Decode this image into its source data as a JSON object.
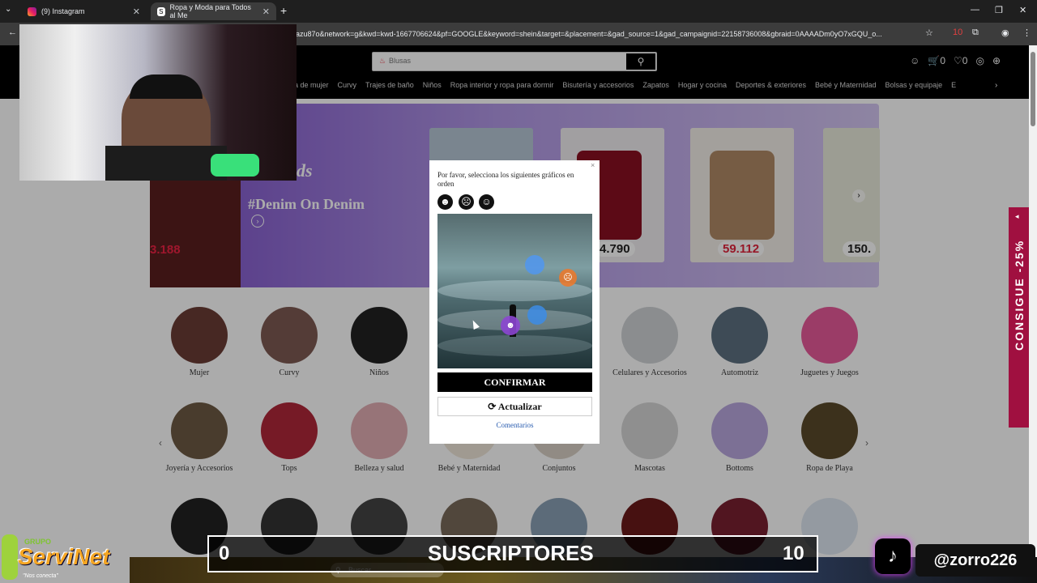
{
  "browser": {
    "tabs": [
      {
        "label": "(9) Instagram"
      },
      {
        "label": "Ropa y Moda para Todos al Me"
      }
    ],
    "url": "azu87o&network=g&kwd=kwd-1667706624&pf=GOOGLE&keyword=shein&target=&placement=&gad_source=1&gad_campaignid=22158736008&gbraid=0AAAADm0yO7xGQU_o...",
    "new_tab": "+",
    "controls": {
      "minimize": "—",
      "restore": "❐",
      "close": "✕"
    },
    "extension_badge": "10"
  },
  "site": {
    "search_value": "Blusas",
    "header_icons": {
      "cart_count": "0",
      "wishlist_count": "0"
    },
    "nav": [
      "ba de mujer",
      "Curvy",
      "Trajes de baño",
      "Niños",
      "Ropa interior y ropa para dormir",
      "Bisutería y accesorios",
      "Zapatos",
      "Hogar y cocina",
      "Deportes & exteriores",
      "Bebé y Maternidad",
      "Bolsas y equipaje",
      "E"
    ],
    "banner": {
      "ds": "ds",
      "title": "#Denim On Denim",
      "left_price": "3.188",
      "prices": [
        "4.790",
        "59.112",
        "150."
      ]
    },
    "categories_row1": [
      "Mujer",
      "Curvy",
      "Niños",
      "Celulares y Accesorios",
      "Automotriz",
      "Juguetes y Juegos"
    ],
    "categories_row2": [
      "Joyería y Accesorios",
      "Tops",
      "Belleza y salud",
      "Bebé y Maternidad",
      "Conjuntos",
      "Mascotas",
      "Bottoms",
      "Ropa de Playa"
    ],
    "side_promo": "CONSIGUE -25%"
  },
  "captcha": {
    "prompt": "Por favor, selecciona los siguientes gráficos en orden",
    "confirm_label": "CONFIRMAR",
    "refresh_label": "Actualizar",
    "refresh_icon": "⟳",
    "feedback_label": "Comentarios",
    "close": "×"
  },
  "stream": {
    "subs_left": "0",
    "subs_title": "SUSCRIPTORES",
    "subs_right": "10",
    "handle": "@zorro226",
    "logo_group": "GRUPO",
    "logo_name": "ServiNet",
    "logo_tag": "\"Nos conecta\""
  },
  "taskbar": {
    "search_placeholder": "Buscar"
  }
}
